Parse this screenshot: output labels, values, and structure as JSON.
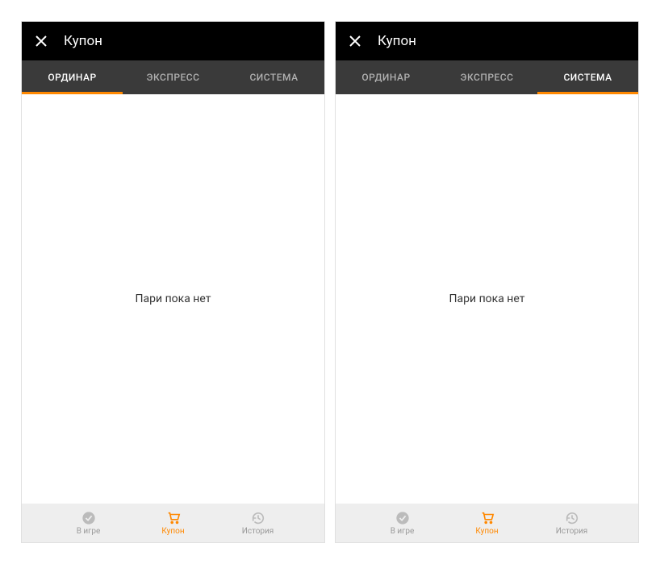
{
  "colors": {
    "accent": "#ff8800",
    "header_bg": "#000000",
    "tabs_bg": "#3a3a3a",
    "bottom_nav_bg": "#eeeeee"
  },
  "left": {
    "header": {
      "title": "Купон"
    },
    "tabs": [
      {
        "label": "ОРДИНАР",
        "active": true
      },
      {
        "label": "ЭКСПРЕСС",
        "active": false
      },
      {
        "label": "СИСТЕМА",
        "active": false
      }
    ],
    "content": {
      "empty": "Пари пока нет"
    },
    "bottom_nav": [
      {
        "label": "В игре",
        "icon": "check-circle-icon",
        "active": false
      },
      {
        "label": "Купон",
        "icon": "cart-icon",
        "active": true
      },
      {
        "label": "История",
        "icon": "history-icon",
        "active": false
      }
    ]
  },
  "right": {
    "header": {
      "title": "Купон"
    },
    "tabs": [
      {
        "label": "ОРДИНАР",
        "active": false
      },
      {
        "label": "ЭКСПРЕСС",
        "active": false
      },
      {
        "label": "СИСТЕМА",
        "active": true
      }
    ],
    "content": {
      "empty": "Пари пока нет"
    },
    "bottom_nav": [
      {
        "label": "В игре",
        "icon": "check-circle-icon",
        "active": false
      },
      {
        "label": "Купон",
        "icon": "cart-icon",
        "active": true
      },
      {
        "label": "История",
        "icon": "history-icon",
        "active": false
      }
    ]
  }
}
